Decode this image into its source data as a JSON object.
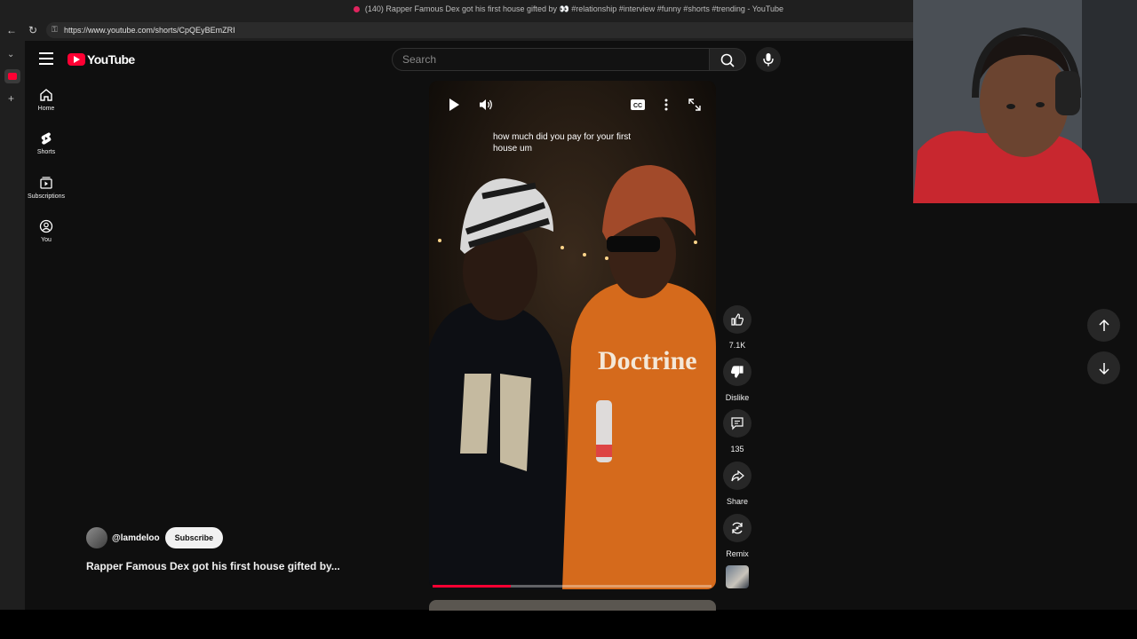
{
  "browser": {
    "window_title": "(140) Rapper Famous Dex got his first house gifted by 👀 #relationship #interview #funny #shorts #trending - YouTube",
    "url": "https://www.youtube.com/shorts/CpQEyBEmZRI"
  },
  "header": {
    "logo_text": "YouTube",
    "search_placeholder": "Search"
  },
  "sidebar": {
    "items": [
      {
        "label": "Home",
        "icon": "home-icon"
      },
      {
        "label": "Shorts",
        "icon": "shorts-icon"
      },
      {
        "label": "Subscriptions",
        "icon": "subscriptions-icon"
      },
      {
        "label": "You",
        "icon": "you-icon"
      }
    ]
  },
  "video": {
    "caption": "how much did you pay for your first house um",
    "progress": 0.28
  },
  "actions": {
    "like_count": "7.1K",
    "dislike_label": "Dislike",
    "comment_count": "135",
    "share_label": "Share",
    "remix_label": "Remix"
  },
  "channel": {
    "handle": "@lamdeloo",
    "subscribe_label": "Subscribe"
  },
  "short_title": "Rapper Famous Dex got his first house gifted by...",
  "colors": {
    "accent": "#ff0033",
    "background": "#0f0f0f",
    "button_bg": "#272727"
  }
}
